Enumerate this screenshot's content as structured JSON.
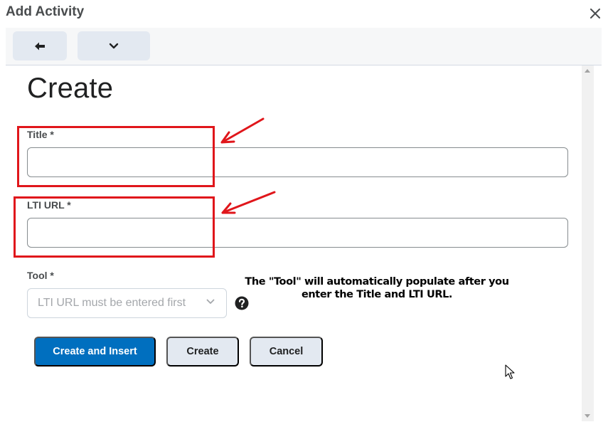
{
  "dialog": {
    "title": "Add Activity"
  },
  "page": {
    "heading": "Create"
  },
  "form": {
    "title_label": "Title *",
    "title_value": "",
    "lti_label": "LTI URL *",
    "lti_value": "",
    "tool_label": "Tool *",
    "tool_placeholder": "LTI URL must be entered first"
  },
  "annotation": {
    "note": "The \"Tool\" will automatically populate after you enter the Title and LTI URL.",
    "color": "#e0161b"
  },
  "buttons": {
    "create_and_insert": "Create and Insert",
    "create": "Create",
    "cancel": "Cancel"
  },
  "colors": {
    "primary": "#006fbf",
    "secondary": "#e3e9f1"
  },
  "icons": {
    "close": "close-icon",
    "back": "back-arrow-icon",
    "menu": "chevron-down-icon",
    "help": "help-icon"
  }
}
